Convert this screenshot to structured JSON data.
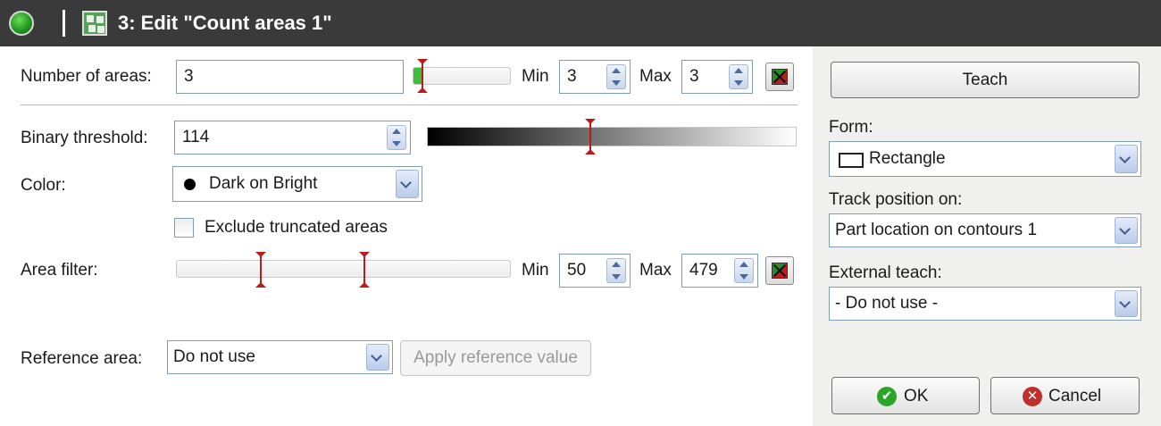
{
  "window": {
    "title": "3: Edit \"Count areas 1\""
  },
  "number_of_areas": {
    "label": "Number of areas:",
    "value": "3",
    "min_label": "Min",
    "min_value": "3",
    "max_label": "Max",
    "max_value": "3"
  },
  "binary_threshold": {
    "label": "Binary threshold:",
    "value": "114",
    "scale_max": 255
  },
  "color": {
    "label": "Color:",
    "selected": "Dark on Bright"
  },
  "exclude_truncated": {
    "label": "Exclude truncated areas",
    "checked": false
  },
  "area_filter": {
    "label": "Area filter:",
    "min_label": "Min",
    "min_value": "50",
    "max_label": "Max",
    "max_value": "479"
  },
  "reference_area": {
    "label": "Reference area:",
    "selected": "Do not use",
    "apply_label": "Apply reference value"
  },
  "right_panel": {
    "teach_label": "Teach",
    "form_label": "Form:",
    "form_value": "Rectangle",
    "track_label": "Track position on:",
    "track_value": "Part location on contours 1",
    "external_teach_label": "External teach:",
    "external_teach_value": "- Do not use -",
    "ok_label": "OK",
    "cancel_label": "Cancel"
  },
  "colors": {
    "titlebar": "#3a3a3a",
    "marker_red": "#b81c1c",
    "ok_green": "#2aa52a",
    "cancel_red": "#c0302a"
  }
}
